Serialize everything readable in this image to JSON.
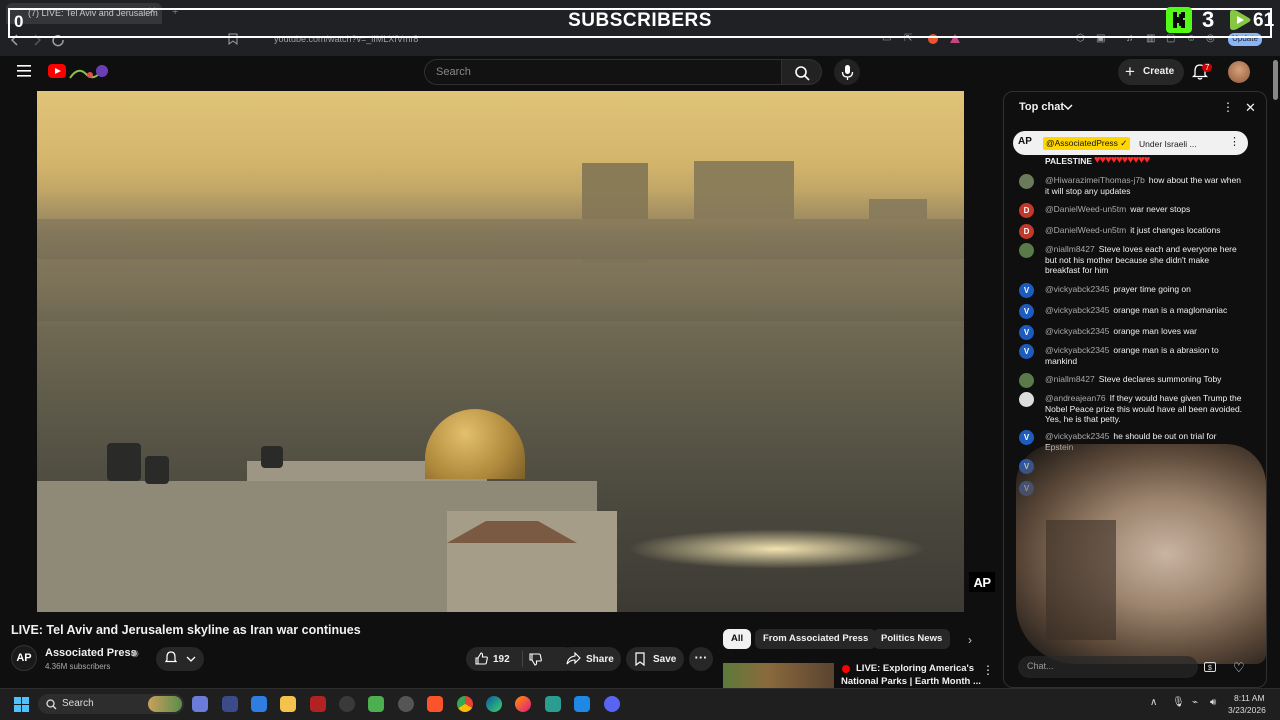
{
  "browser": {
    "tab_title": "(7) LIVE: Tel Aviv and Jerusalem",
    "tab_close": "✕",
    "new_tab": "+",
    "url": "youtube.com/watch?v=_iIMLXfVmr8",
    "update_label": "Update"
  },
  "overlay": {
    "title": "SUBSCRIBERS",
    "left_count": "0",
    "kick_count": "3",
    "rumble_count": "61",
    "kick_color": "#53fc18",
    "rumble_color": "#85c742"
  },
  "header": {
    "search_placeholder": "Search",
    "create_label": "Create",
    "notification_count": "7"
  },
  "video": {
    "title": "LIVE: Tel Aviv and Jerusalem skyline as Iran war continues",
    "watermark": "AP"
  },
  "channel": {
    "avatar_text": "AP",
    "name": "Associated Press",
    "subscribers": "4.36M subscribers"
  },
  "actions": {
    "likes": "192",
    "share_label": "Share",
    "save_label": "Save",
    "more": "···"
  },
  "chips": [
    "All",
    "From Associated Press",
    "Politics News"
  ],
  "recommendation": {
    "title_line1": "LIVE: Exploring America's",
    "title_line2": "National Parks | Earth Month ..."
  },
  "chat": {
    "header": "Top chat",
    "pinned_avatar": "AP",
    "pinned_author": "@AssociatedPress ✓",
    "pinned_text": "Under Israeli ...",
    "first_line": "PALESTINE",
    "hearts": "♥♥♥♥♥♥♥♥♥♥",
    "input_placeholder": "Chat...",
    "messages": [
      {
        "avatar": "",
        "color": "#6b7a5a",
        "author": "@HiwarazimeiThomas-j7b",
        "text": "how about the war when it will stop any updates"
      },
      {
        "avatar": "D",
        "color": "#c0392b",
        "author": "@DanielWeed-un5tm",
        "text": "war never stops"
      },
      {
        "avatar": "D",
        "color": "#c0392b",
        "author": "@DanielWeed-un5tm",
        "text": "it just changes locations"
      },
      {
        "avatar": "",
        "color": "#5a7a4a",
        "author": "@niallm8427",
        "text": "Steve loves each and everyone here but not his mother because she didn't make breakfast for him"
      },
      {
        "avatar": "V",
        "color": "#1e5bbf",
        "author": "@vickyabck2345",
        "text": "prayer time going on"
      },
      {
        "avatar": "V",
        "color": "#1e5bbf",
        "author": "@vickyabck2345",
        "text": "orange man is a maglomaniac"
      },
      {
        "avatar": "V",
        "color": "#1e5bbf",
        "author": "@vickyabck2345",
        "text": "orange man loves war"
      },
      {
        "avatar": "V",
        "color": "#1e5bbf",
        "author": "@vickyabck2345",
        "text": "orange man is a abrasion to mankind"
      },
      {
        "avatar": "",
        "color": "#5a7a4a",
        "author": "@niallm8427",
        "text": "Steve declares summoning Toby"
      },
      {
        "avatar": "",
        "color": "#dddddd",
        "author": "@andreajean76",
        "text": "If they would have given Trump the Nobel Peace prize this would have all been avoided. Yes, he is that petty."
      },
      {
        "avatar": "V",
        "color": "#1e5bbf",
        "author": "@vickyabck2345",
        "text": "he should be out on trial for Epstein"
      }
    ]
  },
  "taskbar": {
    "search_label": "Search",
    "time": "8:11 AM",
    "date": "3/23/2026"
  }
}
